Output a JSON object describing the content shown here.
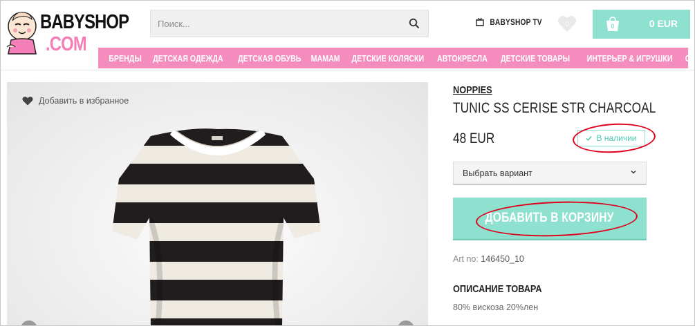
{
  "header": {
    "logo_line1": "BABYSHOP",
    "logo_line2": ".COM",
    "search_placeholder": "Поиск...",
    "tv_label": "BABYSHOP TV",
    "favorites_count": "0",
    "cart_count": "0",
    "cart_total": "0 EUR"
  },
  "nav": {
    "items": [
      {
        "label": "БРЕНДЫ"
      },
      {
        "label": "ДЕТСКАЯ ОДЕЖДА"
      },
      {
        "label": "ДЕТСКАЯ ОБУВЬ"
      },
      {
        "label": "МАМАМ"
      },
      {
        "label": "ДЕТСКИЕ КОЛЯСКИ"
      },
      {
        "label": "АВТОКРЕСЛА"
      },
      {
        "label": "ДЕТСКИЕ ТОВАРЫ"
      },
      {
        "label": "ИНТЕРЬЕР & ИГРУШКИ"
      },
      {
        "label": "СКИДКИ"
      }
    ]
  },
  "gallery": {
    "add_to_favorites": "Добавить в избранное"
  },
  "product": {
    "brand": "NOPPIES",
    "title": "TUNIC SS CERISE STR CHARCOAL",
    "price": "48 EUR",
    "stock": "В наличии",
    "variant_placeholder": "Выбрать вариант",
    "add_to_cart": "ДОБАВИТЬ В КОРЗИНУ",
    "art_label": "Art no:",
    "art_no": "146450_10",
    "description_heading": "ОПИСАНИЕ ТОВАРА",
    "description_text": "80% вискоза 20%лен"
  },
  "colors": {
    "accent_mint": "#8ee0cf",
    "nav_pink": "#f48cbe",
    "annotation_red": "#e0001b"
  }
}
